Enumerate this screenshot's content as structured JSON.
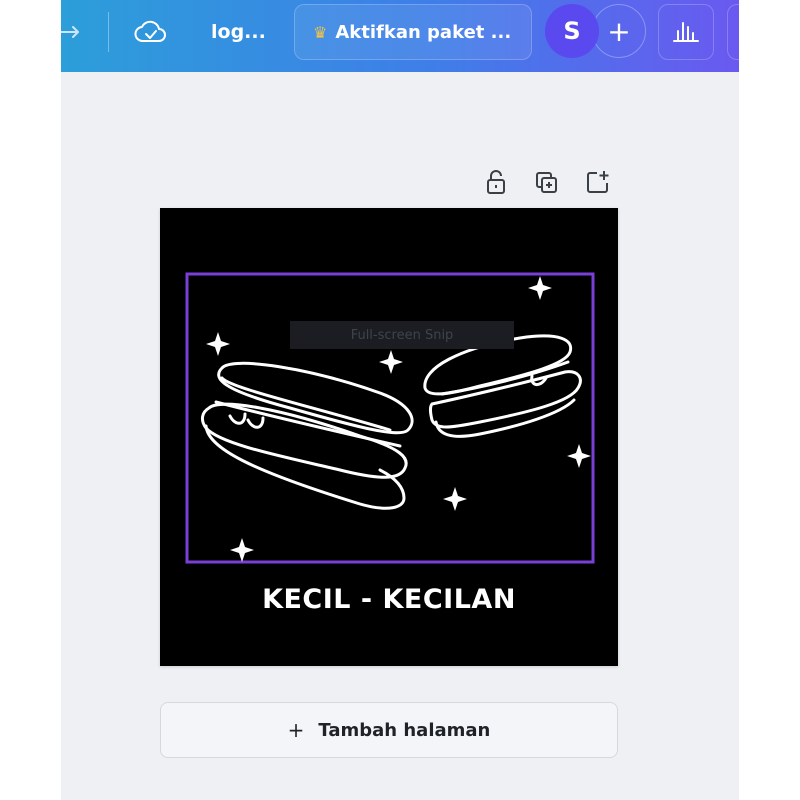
{
  "topbar": {
    "doc_title": "log...",
    "upgrade_label": "Aktifkan paket ...",
    "avatar_initial": "S",
    "add_collaborator_symbol": "+"
  },
  "icons": {
    "share": "share-arrow-icon",
    "save_status": "cloud-check-icon",
    "upgrade": "crown-icon",
    "stats": "bar-chart-icon",
    "lock": "unlock-icon",
    "duplicate": "duplicate-page-icon",
    "add_page": "add-page-icon"
  },
  "canvas": {
    "watermark_text": "Full-screen Snip",
    "headline": "KECIL - KECILAN"
  },
  "footer": {
    "add_page_label": "Tambah halaman",
    "add_page_symbol": "+"
  },
  "colors": {
    "topbar_start": "#2c9ed9",
    "topbar_end": "#6a59f0",
    "frame_purple": "#7a3fd6",
    "canvas_bg": "#000000",
    "avatar": "#5a49ee"
  }
}
